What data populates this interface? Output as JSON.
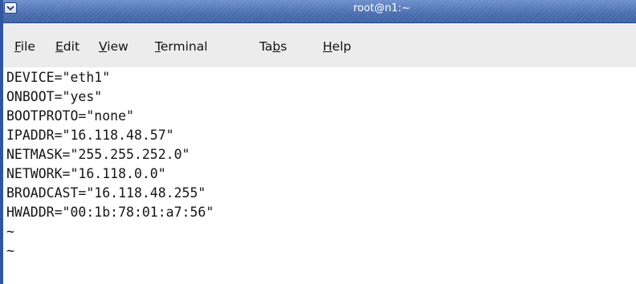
{
  "window": {
    "title": "root@n1:~"
  },
  "menubar": {
    "items": [
      {
        "pre": "",
        "ul": "F",
        "post": "ile"
      },
      {
        "pre": "",
        "ul": "E",
        "post": "dit"
      },
      {
        "pre": "",
        "ul": "V",
        "post": "iew"
      },
      {
        "pre": "",
        "ul": "T",
        "post": "erminal"
      },
      {
        "pre": "Ta",
        "ul": "b",
        "post": "s"
      },
      {
        "pre": "",
        "ul": "H",
        "post": "elp"
      }
    ]
  },
  "terminal": {
    "lines": [
      "DEVICE=\"eth1\"",
      "ONBOOT=\"yes\"",
      "BOOTPROTO=\"none\"",
      "IPADDR=\"16.118.48.57\"",
      "NETMASK=\"255.255.252.0\"",
      "NETWORK=\"16.118.0.0\"",
      "BROADCAST=\"16.118.48.255\"",
      "HWADDR=\"00:1b:78:01:a7:56\"",
      "~",
      "~"
    ]
  },
  "icons": {
    "window_menu": "chevron-down-icon"
  },
  "colors": {
    "titlebar": "#4a6fb1",
    "menubar": "#ececec",
    "terminal_bg": "#ffffff",
    "terminal_fg": "#151515"
  }
}
